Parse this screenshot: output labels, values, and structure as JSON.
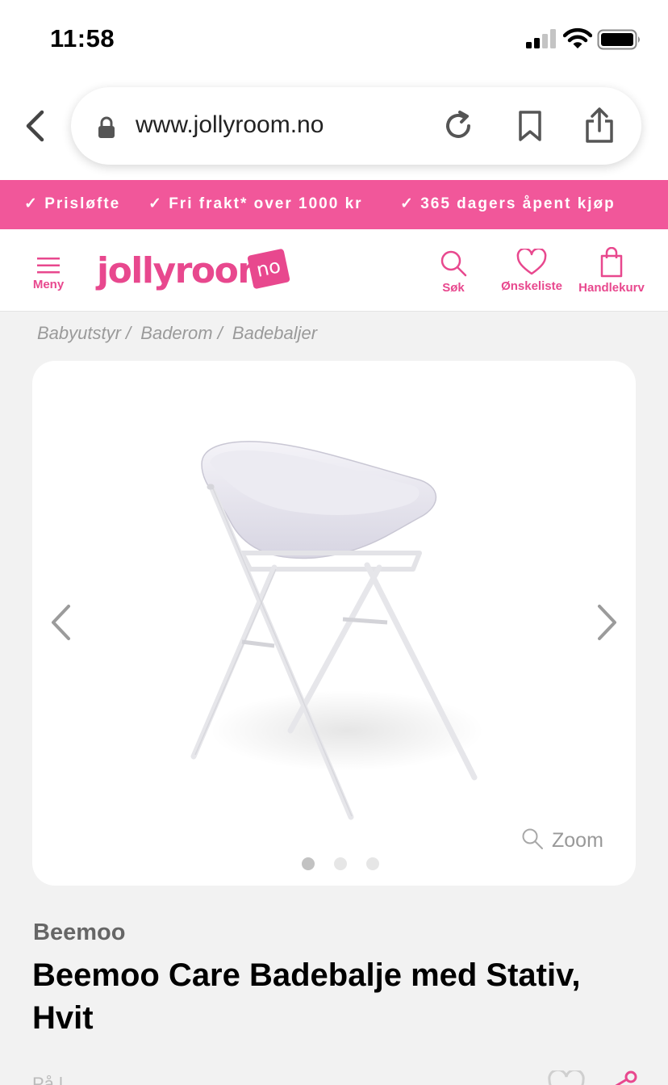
{
  "status_bar": {
    "time": "11:58"
  },
  "browser": {
    "url": "www.jollyroom.no"
  },
  "promo": {
    "items": [
      "✓ Prisløfte",
      "✓ Fri frakt* over 1000 kr",
      "✓ 365 dagers åpent kjøp"
    ]
  },
  "header": {
    "menu_label": "Meny",
    "logo_text": "jollyroom",
    "logo_badge": "no",
    "search_label": "Søk",
    "wishlist_label": "Ønskeliste",
    "cart_label": "Handlekurv"
  },
  "breadcrumb": [
    "Babyutstyr /",
    "Baderom /",
    "Badebaljer"
  ],
  "gallery": {
    "zoom_label": "Zoom",
    "slide_count": 3,
    "active_slide": 1
  },
  "product": {
    "brand": "Beemoo",
    "title": "Beemoo Care Badebalje med Stativ, Hvit",
    "cut_text": "På l"
  },
  "colors": {
    "brand_pink": "#f1579a",
    "header_pink": "#e8488e",
    "page_bg": "#f2f2f2"
  }
}
